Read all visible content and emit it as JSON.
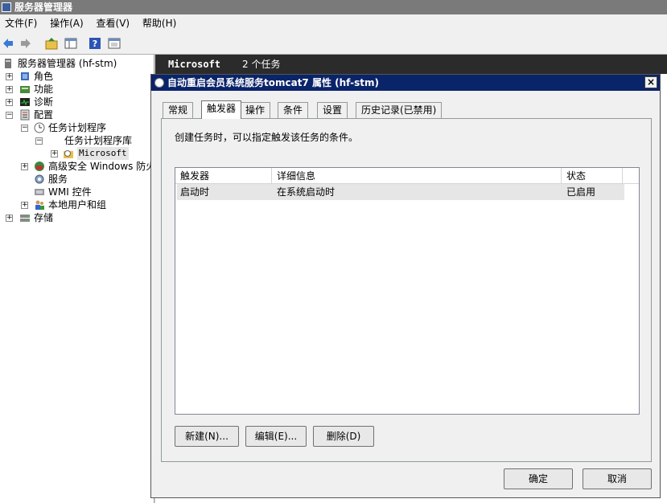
{
  "window": {
    "title": "服务器管理器"
  },
  "menu": [
    "文件(F)",
    "操作(A)",
    "查看(V)",
    "帮助(H)"
  ],
  "toolbar": {
    "icons": [
      "back-arrow-icon",
      "forward-arrow-icon",
      "up-folder-icon",
      "show-hide-tree-icon",
      "help-icon",
      "properties-icon"
    ]
  },
  "tree": {
    "root": "服务器管理器 (hf-stm)",
    "roles": "角色",
    "features": "功能",
    "diagnostics": "诊断",
    "configuration": "配置",
    "task_scheduler": "任务计划程序",
    "task_library": "任务计划程序库",
    "microsoft": "Microsoft",
    "firewall": "高级安全 Windows 防火",
    "services": "服务",
    "wmi": "WMI 控件",
    "local_users": "本地用户和组",
    "storage": "存储"
  },
  "right_pane": {
    "folder": "Microsoft",
    "task_count": "2 个任务"
  },
  "dialog": {
    "title": "自动重启会员系统服务tomcat7 属性 (hf-stm)",
    "close": "×",
    "tabs": [
      "常规",
      "触发器",
      "操作",
      "条件",
      "设置",
      "历史记录(已禁用)"
    ],
    "active_tab": "触发器",
    "description": "创建任务时，可以指定触发该任务的条件。",
    "columns": [
      "触发器",
      "详细信息",
      "状态"
    ],
    "rows": [
      {
        "trigger": "启动时",
        "details": "在系统启动时",
        "status": "已启用"
      }
    ],
    "buttons": {
      "new": "新建(N)...",
      "edit": "编辑(E)...",
      "delete": "删除(D)"
    },
    "ok": "确定",
    "cancel": "取消"
  }
}
